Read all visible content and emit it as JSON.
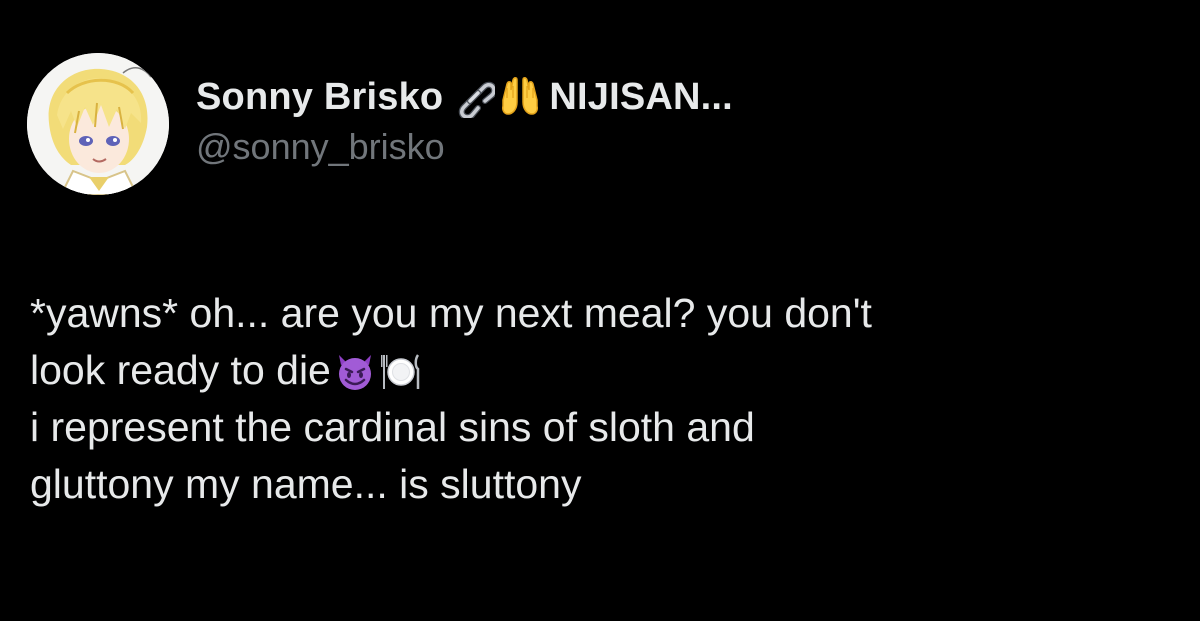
{
  "author": {
    "display_name": "Sonny Brisko",
    "name_suffix": "NIJISAN...",
    "handle": "@sonny_brisko",
    "name_emojis": [
      "chain-link-icon",
      "raising-hands-icon"
    ]
  },
  "tweet": {
    "lines": [
      "*yawns* oh... are you my next meal? you don't",
      "look ready to die",
      "i represent the cardinal sins of sloth and",
      "gluttony my name... is sluttony"
    ],
    "line_2_emojis": [
      "smiling-devil-icon",
      "plate-cutlery-icon"
    ]
  },
  "colors": {
    "background": "#000000",
    "primary_text": "#e7e9ea",
    "secondary_text": "#71767b"
  }
}
